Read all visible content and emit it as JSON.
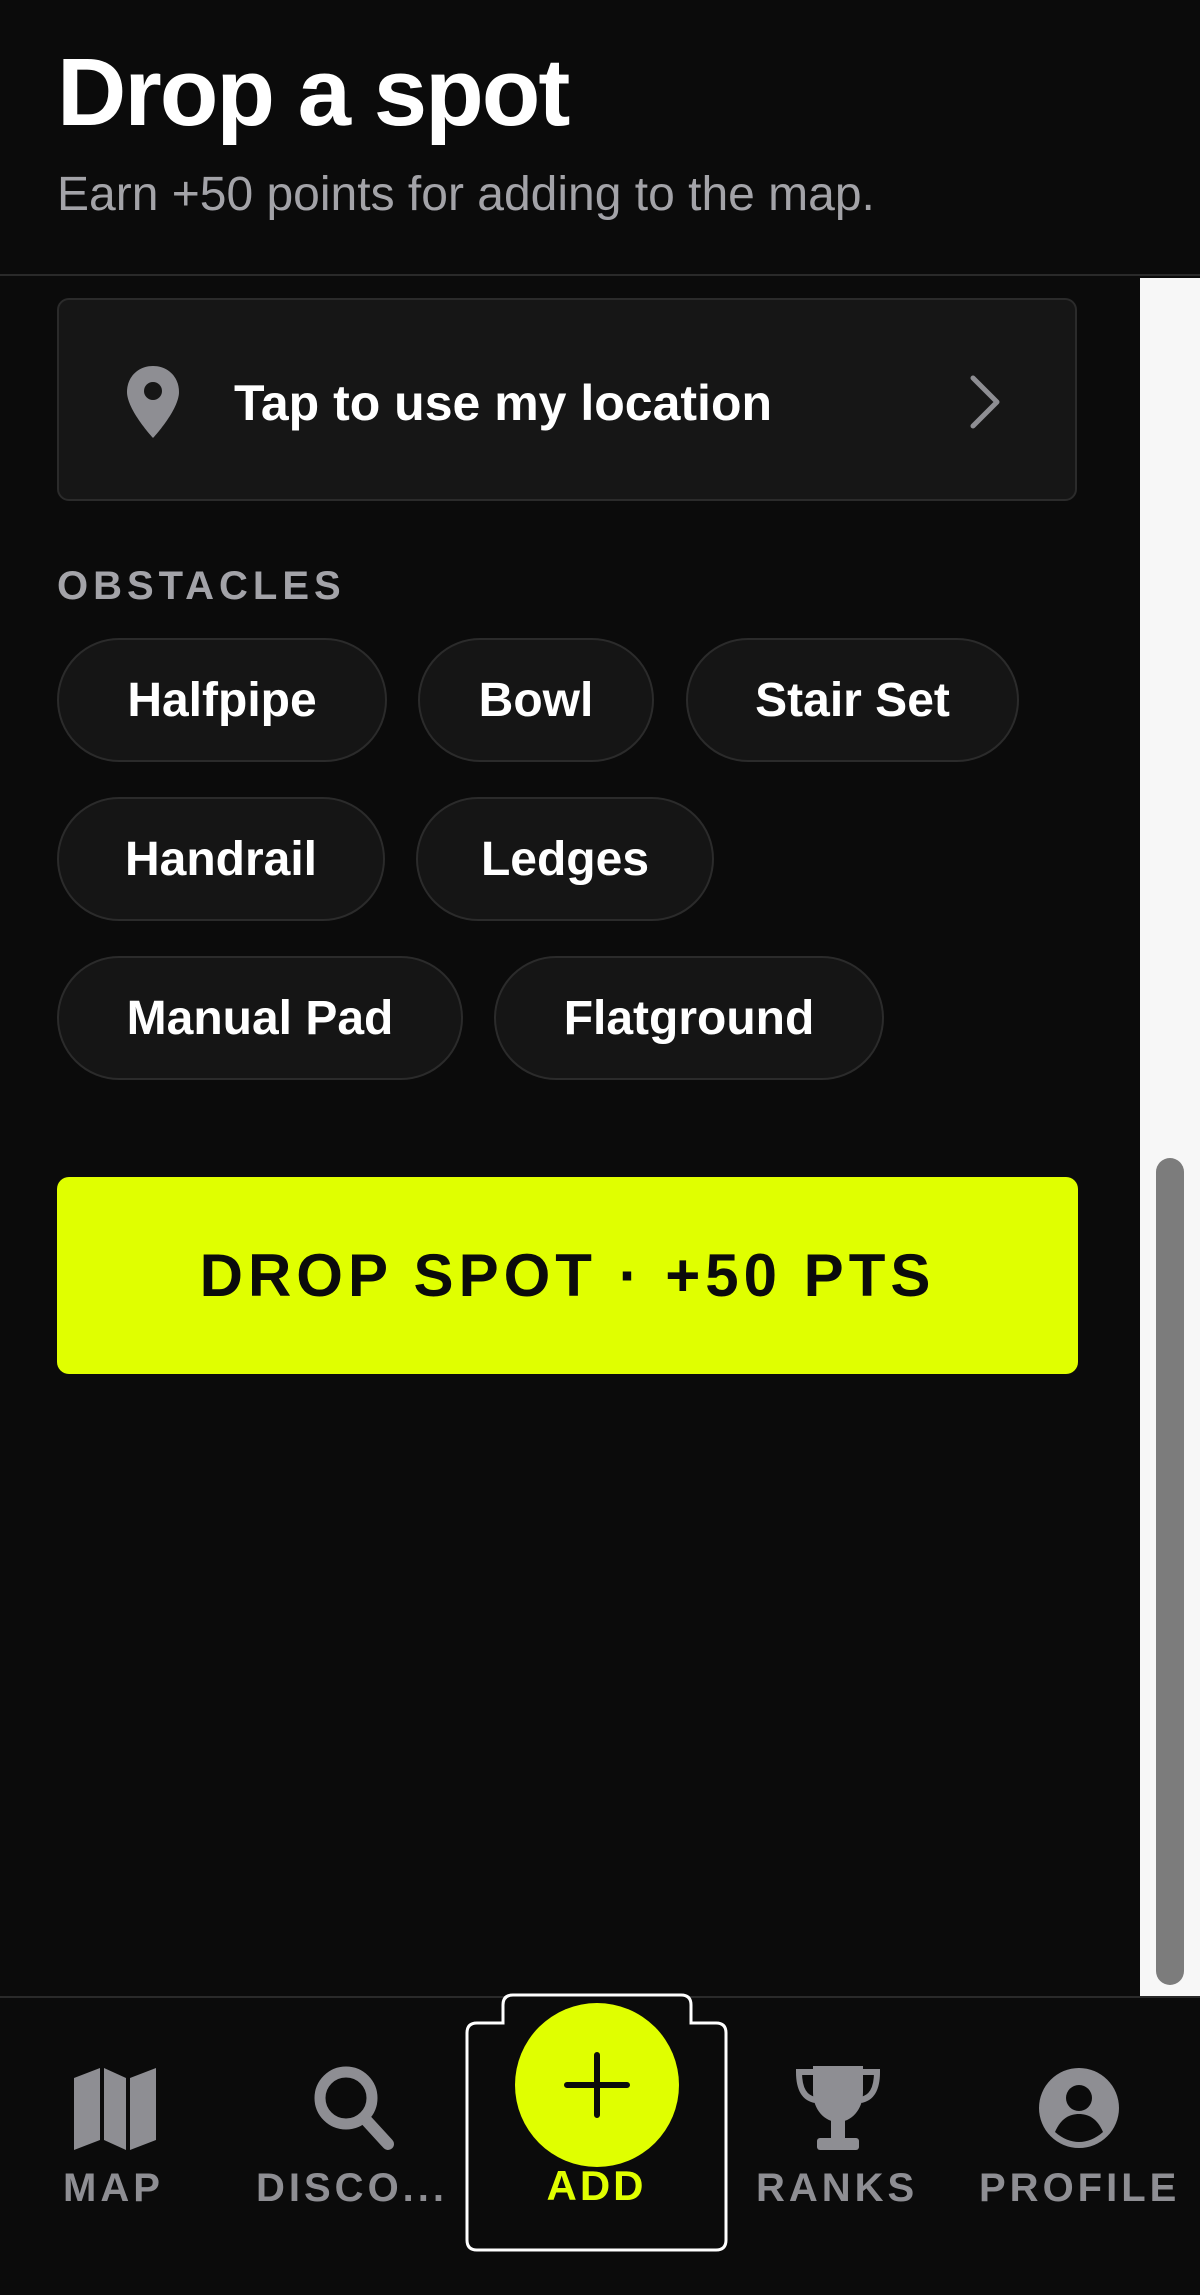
{
  "header": {
    "title": "Drop a spot",
    "subtitle": "Earn +50 points for adding to the map."
  },
  "location": {
    "label": "Tap to use my location",
    "icon": "map-pin-icon"
  },
  "obstacles": {
    "section_label": "OBSTACLES",
    "chips": [
      "Halfpipe",
      "Bowl",
      "Stair Set",
      "Handrail",
      "Ledges",
      "Manual Pad",
      "Flatground"
    ]
  },
  "submit": {
    "label": "DROP SPOT · +50 PTS"
  },
  "nav": {
    "items": [
      {
        "label": "MAP",
        "icon": "map-icon"
      },
      {
        "label": "DISCO...",
        "icon": "search-icon"
      },
      {
        "label": "ADD",
        "icon": "plus-icon"
      },
      {
        "label": "RANKS",
        "icon": "trophy-icon"
      },
      {
        "label": "PROFILE",
        "icon": "user-icon"
      }
    ],
    "active": "ADD"
  },
  "colors": {
    "accent": "#e0ff00",
    "background": "#0b0b0b",
    "surface": "#161616",
    "muted": "#8e8e93"
  }
}
